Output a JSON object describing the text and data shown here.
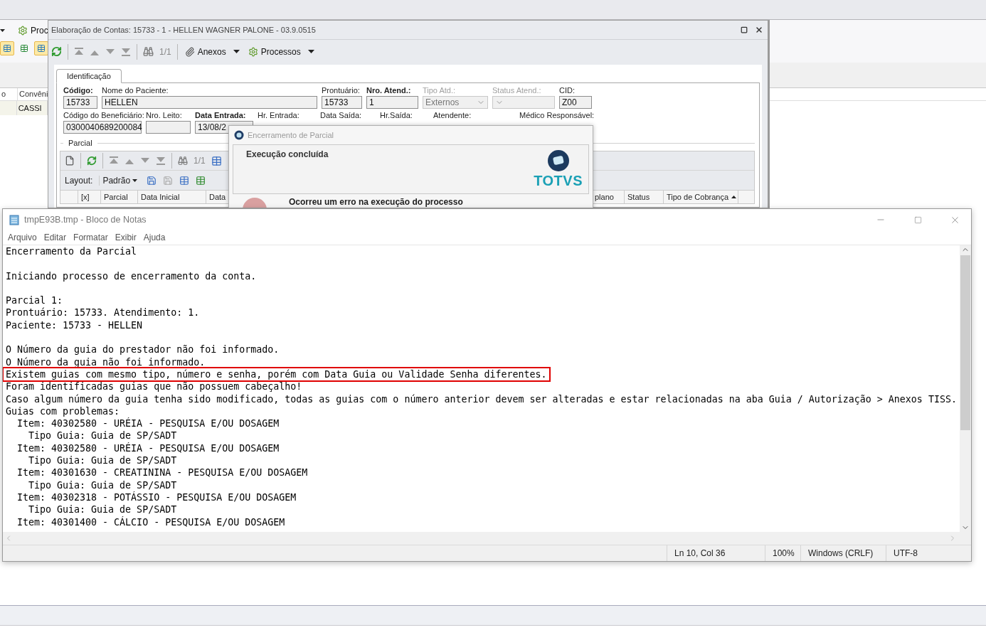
{
  "background_app": {
    "toolbar_label": "Proc",
    "columns": [
      "o",
      "Convêni"
    ],
    "rows": [
      [
        "",
        "CASSI"
      ]
    ]
  },
  "main_window": {
    "title": "Elaboração de Contas: 15733 - 1 - HELLEN WAGNER PALONE - 03.9.0515",
    "toolbar": {
      "counter": "1/1",
      "menus": [
        "Anexos",
        "Processos"
      ]
    },
    "tabs": [
      {
        "label": "Identificação",
        "selected": true
      }
    ],
    "form_row_1": [
      {
        "label": "Código:",
        "value": "15733",
        "bold": true,
        "disabled": false,
        "kind": "text"
      },
      {
        "label": "Nome do Paciente:",
        "value": "HELLEN",
        "bold": false,
        "disabled": false,
        "kind": "text"
      },
      {
        "label": "Prontuário:",
        "value": "15733",
        "bold": false,
        "disabled": false,
        "kind": "text"
      },
      {
        "label": "Nro. Atend.:",
        "value": "1",
        "bold": true,
        "disabled": false,
        "kind": "text"
      },
      {
        "label": "Tipo Atd.:",
        "value": "Externos",
        "bold": false,
        "disabled": true,
        "kind": "combo"
      },
      {
        "label": "Status Atend.:",
        "bold": false,
        "disabled": true,
        "kind": "combo"
      },
      {
        "label": "CID:",
        "value": "Z00",
        "bold": false,
        "disabled": false,
        "kind": "text"
      }
    ],
    "form_row_2": [
      {
        "label": "Código do Beneficiário:",
        "value": "0300040689200084",
        "bold": false,
        "disabled": false,
        "kind": "text"
      },
      {
        "label": "Nro. Leito:",
        "bold": false,
        "disabled": false,
        "kind": "text"
      },
      {
        "label": "Data Entrada:",
        "value": "13/08/2",
        "bold": true,
        "disabled": false,
        "kind": "text"
      },
      {
        "label": "Hr. Entrada:",
        "bold": false,
        "disabled": false,
        "kind": "label"
      },
      {
        "label": "Data Saída:",
        "bold": false,
        "disabled": false,
        "kind": "label"
      },
      {
        "label": "Hr.Saída:",
        "bold": false,
        "disabled": false,
        "kind": "label"
      },
      {
        "label": "Atendente:",
        "bold": false,
        "disabled": false,
        "kind": "label"
      },
      {
        "label": "Médico Responsável:",
        "bold": false,
        "disabled": false,
        "kind": "label"
      }
    ],
    "parcial": {
      "title": "Parcial",
      "counter": "1/1",
      "layout_label": "Layout:",
      "layout_value": "Padrão",
      "columns_left": [
        "[x]",
        "Parcial",
        "Data Inicial",
        "Data"
      ],
      "columns_right": [
        {
          "label": "plano",
          "sorted": false
        },
        {
          "label": "Status",
          "sorted": false
        },
        {
          "label": "Tipo de Cobrança",
          "sorted": true
        }
      ]
    }
  },
  "dialog": {
    "title": "Encerramento de Parcial",
    "heading": "Execução concluída",
    "logo": "TOTVS",
    "message": "Ocorreu um erro na execução do processo"
  },
  "notepad": {
    "title": "tmpE93B.tmp - Bloco de Notas",
    "menu": [
      "Arquivo",
      "Editar",
      "Formatar",
      "Exibir",
      "Ajuda"
    ],
    "blocks": [
      [
        {
          "text": "Encerramento da Parcial",
          "highlighted": false
        }
      ],
      [
        {
          "text": "Iniciando processo de encerramento da conta.",
          "highlighted": false
        }
      ],
      [
        {
          "text": "Parcial 1:",
          "highlighted": false
        },
        {
          "text": "Prontuário: 15733. Atendimento: 1.",
          "highlighted": false
        },
        {
          "text": "Paciente: 15733 - HELLEN",
          "highlighted": false
        }
      ],
      [
        {
          "text": "O Número da guia do prestador não foi informado.",
          "highlighted": false
        },
        {
          "text": "O Número da guia não foi informado.",
          "highlighted": false
        },
        {
          "text": "Existem guias com mesmo tipo, número e senha, porém com Data Guia ou Validade Senha diferentes.",
          "highlighted": true
        },
        {
          "text": "Foram identificadas guias que não possuem cabeçalho!",
          "highlighted": false
        },
        {
          "text": "Caso algum número da guia tenha sido modificado, todas as guias com o número anterior devem ser alteradas e estar relacionadas na aba Guia / Autorização > Anexos TISS.",
          "highlighted": false
        },
        {
          "text": "Guias com problemas:",
          "highlighted": false
        },
        {
          "text": "  Item: 40302580 - URÉIA - PESQUISA E/OU DOSAGEM",
          "highlighted": false
        },
        {
          "text": "    Tipo Guia: Guia de SP/SADT",
          "highlighted": false
        },
        {
          "text": "  Item: 40302580 - URÉIA - PESQUISA E/OU DOSAGEM",
          "highlighted": false
        },
        {
          "text": "    Tipo Guia: Guia de SP/SADT",
          "highlighted": false
        },
        {
          "text": "  Item: 40301630 - CREATININA - PESQUISA E/OU DOSAGEM",
          "highlighted": false
        },
        {
          "text": "    Tipo Guia: Guia de SP/SADT",
          "highlighted": false
        },
        {
          "text": "  Item: 40302318 - POTÁSSIO - PESQUISA E/OU DOSAGEM",
          "highlighted": false
        },
        {
          "text": "    Tipo Guia: Guia de SP/SADT",
          "highlighted": false
        },
        {
          "text": "  Item: 40301400 - CÁLCIO - PESQUISA E/OU DOSAGEM",
          "highlighted": false
        }
      ]
    ],
    "status": [
      "Ln 10, Col 36",
      "100%",
      "Windows (CRLF)",
      "UTF-8"
    ]
  }
}
